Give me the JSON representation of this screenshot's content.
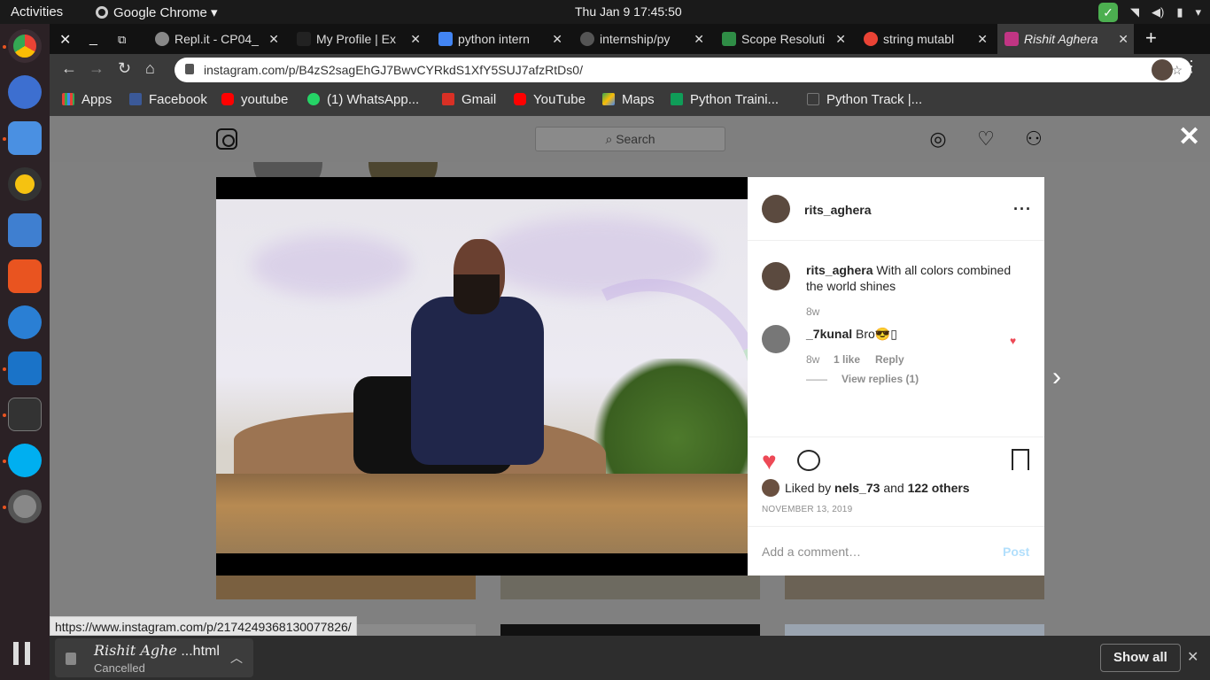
{
  "system": {
    "activities": "Activities",
    "app_name": "Google Chrome",
    "clock": "Thu Jan 9  17:45:50"
  },
  "tabs": [
    {
      "label": "Repl.it - CP04_",
      "color": "#888888"
    },
    {
      "label": "My Profile | Ex",
      "color": "#222222"
    },
    {
      "label": "python intern",
      "color": "#4285f4"
    },
    {
      "label": "internship/py",
      "color": "#555555"
    },
    {
      "label": "Scope Resoluti",
      "color": "#2f8d46"
    },
    {
      "label": "string mutabl",
      "color": "#ea4335"
    },
    {
      "label": "Rishit Aghera",
      "color": "#c13584"
    }
  ],
  "toolbar": {
    "url": "instagram.com/p/B4zS2sagEhGJ7BwvCYRkdS1XfY5SUJ7afzRtDs0/"
  },
  "bookmarks": [
    {
      "label": "Apps",
      "color": "#e94235"
    },
    {
      "label": "Facebook",
      "color": "#3b5998"
    },
    {
      "label": "youtube",
      "color": "#ff0000"
    },
    {
      "label": "(1) WhatsApp...",
      "color": "#25d366"
    },
    {
      "label": "Gmail",
      "color": "#d93025"
    },
    {
      "label": "YouTube",
      "color": "#ff0000"
    },
    {
      "label": "Maps",
      "color": "#34a853"
    },
    {
      "label": "Python Traini...",
      "color": "#0f9d58"
    },
    {
      "label": "Python Track |...",
      "color": "#555555"
    }
  ],
  "instagram": {
    "search_placeholder": "Search",
    "username": "rits_aghera",
    "caption_user": "rits_aghera",
    "caption_text": "With all colors combined the world shines",
    "caption_time": "8w",
    "comment": {
      "user": "_7kunal",
      "text": "Bro😎▯",
      "time": "8w",
      "likes": "1 like",
      "reply": "Reply",
      "view_replies": "View replies (1)"
    },
    "liked_by_prefix": "Liked by",
    "liked_by_user": "nels_73",
    "liked_by_and": "and",
    "liked_by_others": "122 others",
    "date": "NOVEMBER 13, 2019",
    "add_comment_placeholder": "Add a comment…",
    "post_button": "Post",
    "accent_color": "#ed4956"
  },
  "status_url": "https://www.instagram.com/p/2174249368130077826/",
  "download": {
    "name_italic": "Rishit Aghe",
    "name_rest": "...html",
    "status": "Cancelled",
    "show_all": "Show all"
  }
}
